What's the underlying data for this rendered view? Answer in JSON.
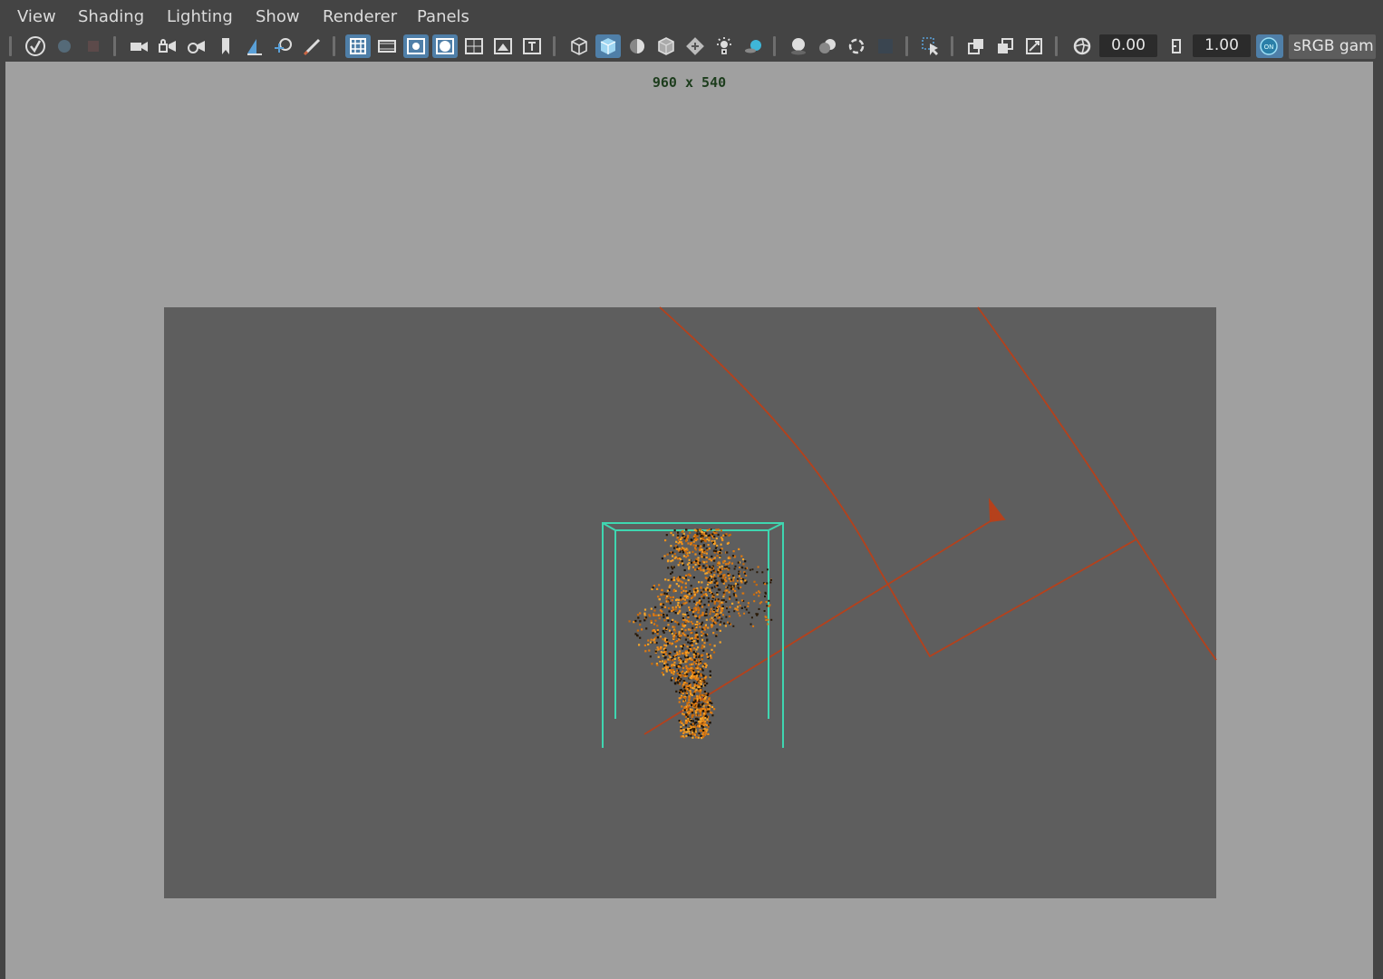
{
  "menu": {
    "items": [
      "View",
      "Shading",
      "Lighting",
      "Show",
      "Renderer",
      "Panels"
    ]
  },
  "toolbar": {
    "exposure_value": "0.00",
    "gamma_value": "1.00",
    "color_management_toggle": "ON",
    "color_space_label": "sRGB gam",
    "icons": [
      "select-camera-icon",
      "camera-attributes-icon",
      "bookmarks-icon",
      "camera-icon",
      "lock-camera-icon",
      "rotate-camera-icon",
      "bookmark-icon",
      "image-plane-icon",
      "2d-pan-zoom-icon",
      "grease-pencil-icon",
      "grid-icon",
      "film-gate-icon",
      "resolution-gate-icon",
      "gate-mask-icon",
      "field-chart-icon",
      "safe-action-icon",
      "safe-title-icon",
      "wireframe-icon",
      "smooth-shade-icon",
      "use-default-material-icon",
      "wireframe-on-shaded-icon",
      "textured-icon",
      "use-all-lights-icon",
      "shadows-icon",
      "screen-space-ao-icon",
      "motion-blur-icon",
      "anti-aliasing-icon",
      "depth-of-field-icon",
      "isolate-select-icon",
      "xray-icon",
      "xray-active-components-icon",
      "xray-joints-icon",
      "exposure-icon",
      "gamma-icon",
      "color-management-icon"
    ]
  },
  "viewport": {
    "resolution_label": "960 x 540"
  },
  "colors": {
    "ui_background": "#444444",
    "viewport_background": "#a0a0a0",
    "render_gate": "#5e5e5e",
    "active_button": "#4f7fa8",
    "container_wireframe": "#3fd6b0",
    "curve_wireframe": "#b5411c",
    "fire_particles": "#f0901a"
  }
}
